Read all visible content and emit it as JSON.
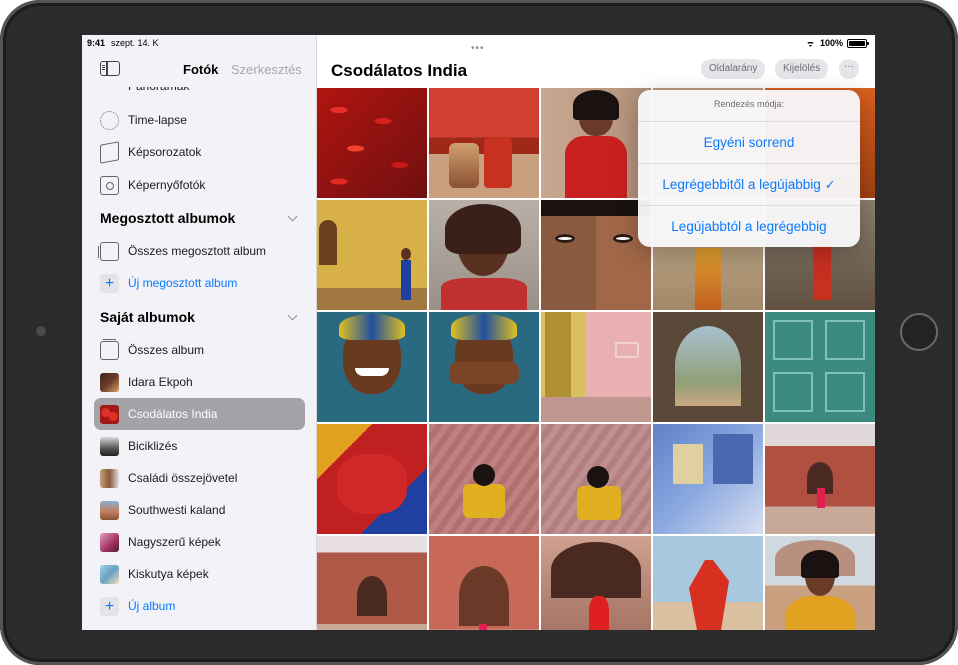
{
  "status": {
    "time": "9:41",
    "date": "szept. 14. K",
    "battery": "100%"
  },
  "sidebar": {
    "title": "Fotók",
    "edit": "Szerkesztés",
    "media_items": [
      {
        "label": "Panorámák",
        "icon": "panorama-icon"
      },
      {
        "label": "Time-lapse",
        "icon": "timelapse-icon"
      },
      {
        "label": "Képsorozatok",
        "icon": "burst-icon"
      },
      {
        "label": "Képernyőfotók",
        "icon": "screenshot-icon"
      }
    ],
    "shared_section": "Megosztott albumok",
    "shared_items": [
      {
        "label": "Összes megosztott album",
        "icon": "shared-albums-icon"
      },
      {
        "label": "Új megosztott album",
        "icon": "plus-icon"
      }
    ],
    "my_section": "Saját albumok",
    "my_items": [
      {
        "label": "Összes album",
        "icon": "albums-icon"
      },
      {
        "label": "Idara Ekpoh",
        "icon": "album-thumb",
        "color": "#6b3a2a"
      },
      {
        "label": "Csodálatos India",
        "icon": "album-thumb",
        "color": "#c0201e",
        "selected": true
      },
      {
        "label": "Biciklizés",
        "icon": "album-thumb",
        "color": "#3a3a3a"
      },
      {
        "label": "Családi összejövetel",
        "icon": "album-thumb",
        "color": "#8a5a3a"
      },
      {
        "label": "Southwesti kaland",
        "icon": "album-thumb",
        "color": "#b07050"
      },
      {
        "label": "Nagyszerű képek",
        "icon": "album-thumb",
        "color": "#a03060"
      },
      {
        "label": "Kiskutya képek",
        "icon": "album-thumb",
        "color": "#6aa0c0"
      },
      {
        "label": "Új album",
        "icon": "plus-icon"
      }
    ]
  },
  "main": {
    "title": "Csodálatos India",
    "aspect_button": "Oldalarány",
    "select_button": "Kijelölés",
    "more_button": "···"
  },
  "sort_menu": {
    "header": "Rendezés módja:",
    "options": [
      {
        "label": "Egyéni sorrend",
        "checked": false
      },
      {
        "label": "Legrégebbitől a legújabbig",
        "checked": true
      },
      {
        "label": "Legújabbtól a legrégebbig",
        "checked": false
      }
    ],
    "checkmark": "✓"
  },
  "colors": {
    "accent": "#0a7aff",
    "sidebar_bg": "#f2f2f7",
    "selected_row": "#a3a3a8"
  }
}
